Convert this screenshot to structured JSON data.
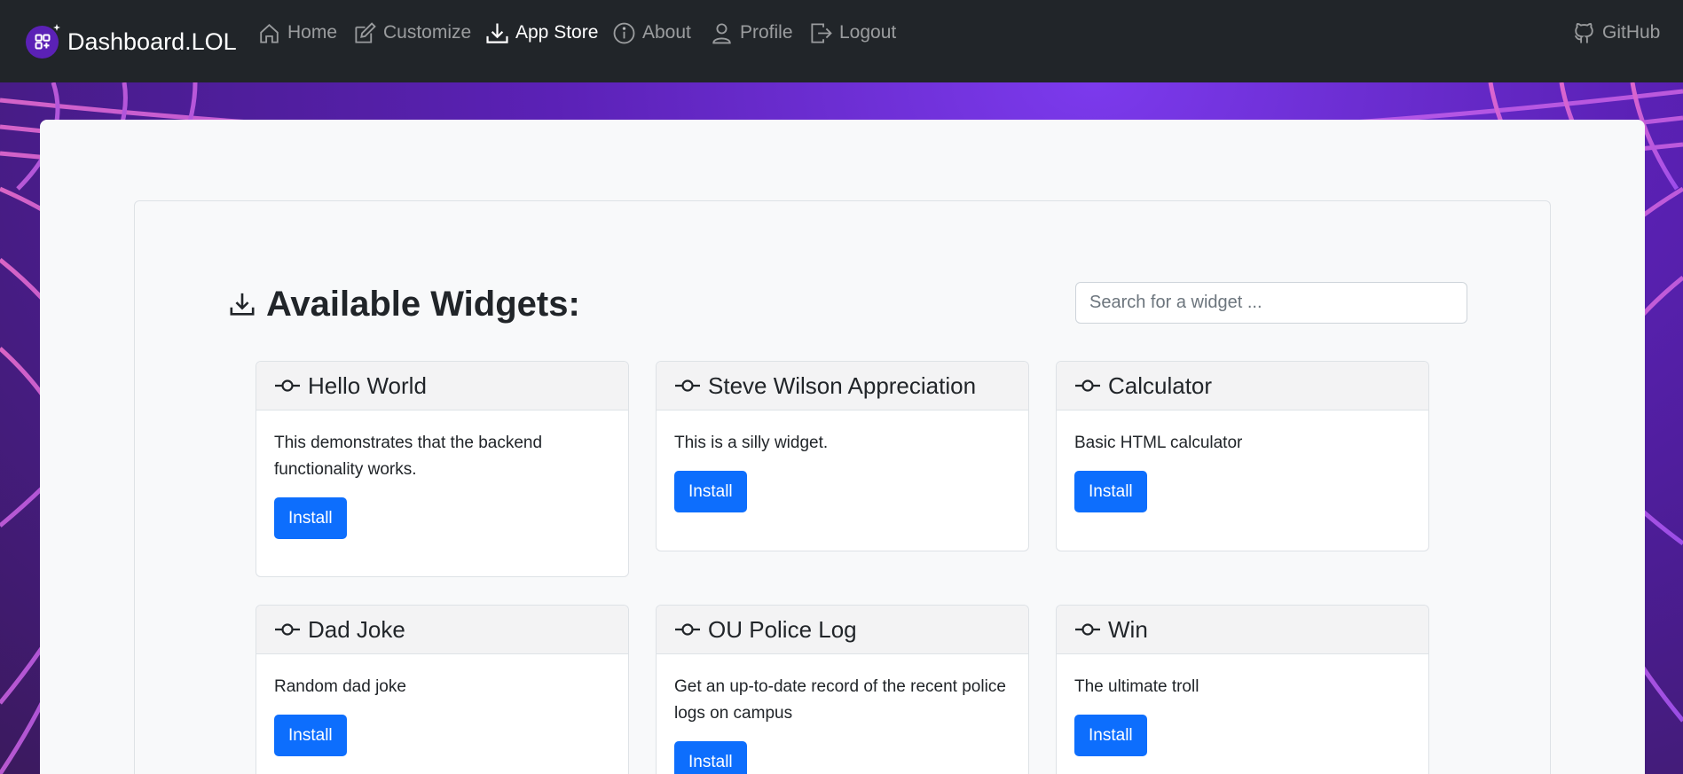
{
  "nav": {
    "brand": "Dashboard.LOL",
    "items": [
      {
        "label": "Home",
        "icon": "house-icon"
      },
      {
        "label": "Customize",
        "icon": "pencil-square-icon"
      },
      {
        "label": "App Store",
        "icon": "download-icon",
        "active": true
      },
      {
        "label": "About",
        "icon": "info-circle-icon"
      },
      {
        "label": "Profile",
        "icon": "person-icon"
      },
      {
        "label": "Logout",
        "icon": "box-arrow-right-icon"
      }
    ],
    "github": "GitHub"
  },
  "page": {
    "heading": "Available Widgets:",
    "search_placeholder": "Search for a widget ..."
  },
  "widgets": [
    {
      "title": "Hello World",
      "description": "This demonstrates that the backend functionality works.",
      "button": "Install"
    },
    {
      "title": "Steve Wilson Appreciation",
      "description": "This is a silly widget.",
      "button": "Install"
    },
    {
      "title": "Calculator",
      "description": "Basic HTML calculator",
      "button": "Install"
    },
    {
      "title": "Dad Joke",
      "description": "Random dad joke",
      "button": "Install"
    },
    {
      "title": "OU Police Log",
      "description": "Get an up-to-date record of the recent police logs on campus",
      "button": "Install"
    },
    {
      "title": "Win",
      "description": "The ultimate troll",
      "button": "Install"
    }
  ],
  "colors": {
    "navbar": "#212529",
    "primary": "#0d6efd",
    "background": "#5b21b6"
  }
}
